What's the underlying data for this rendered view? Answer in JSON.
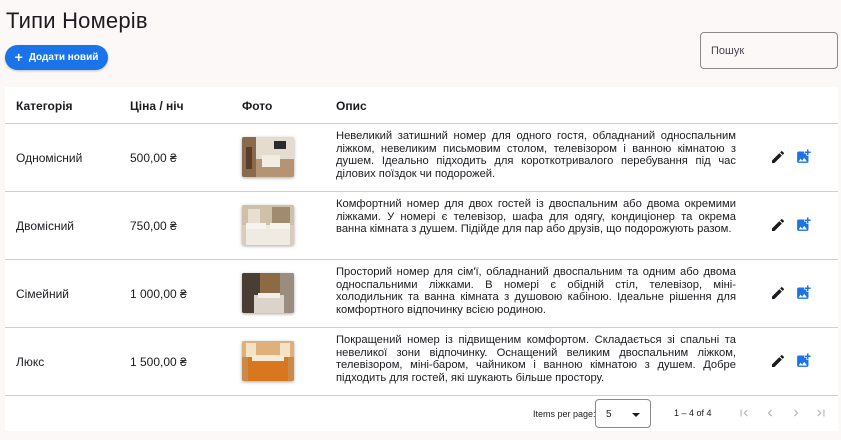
{
  "header": {
    "title": "Типи Номерів",
    "add_button_label": "Додати новий",
    "search_placeholder": "Пошук"
  },
  "table": {
    "columns": [
      "Категорія",
      "Ціна / ніч",
      "Фото",
      "Опис"
    ],
    "rows": [
      {
        "category": "Одномісний",
        "price": "500,00 ₴",
        "description": "Невеликий затишний номер для одного гостя, обладнаний односпальним ліжком, невеликим письмовим столом, телевізором і ванною кімнатою з душем. Ідеально підходить для короткотривалого перебування під час ділових поїздок чи подорожей."
      },
      {
        "category": "Двомісний",
        "price": "750,00 ₴",
        "description": "Комфортний номер для двох гостей із двоспальним або двома окремими ліжками. У номері є телевізор, шафа для одягу, кондиціонер та окрема ванна кімната з душем. Підійде для пар або друзів, що подорожують разом."
      },
      {
        "category": "Сімейний",
        "price": "1 000,00 ₴",
        "description": "Просторий номер для сім'ї, обладнаний двоспальним та одним або двома односпальними ліжками. В номері є обідній стіл, телевізор, міні-холодильник та ванна кімната з душовою кабіною. Ідеальне рішення для комфортного відпочинку всією родиною."
      },
      {
        "category": "Люкс",
        "price": "1 500,00 ₴",
        "description": "Покращений номер із підвищеним комфортом. Складається зі спальні та невеликої зони відпочинку. Оснащений великим двоспальним ліжком, телевізором, міні-баром, чайником і ванною кімнатою з душем. Добре підходить для гостей, які шукають більше простору."
      }
    ]
  },
  "paginator": {
    "items_per_page_label": "Items per page:",
    "items_per_page_value": "5",
    "range_label": "1 – 4 of 4"
  },
  "colors": {
    "primary": "#1a73e8",
    "background": "#fcf8f8",
    "text": "#1d1b20",
    "divider": "#cfcfcf"
  }
}
